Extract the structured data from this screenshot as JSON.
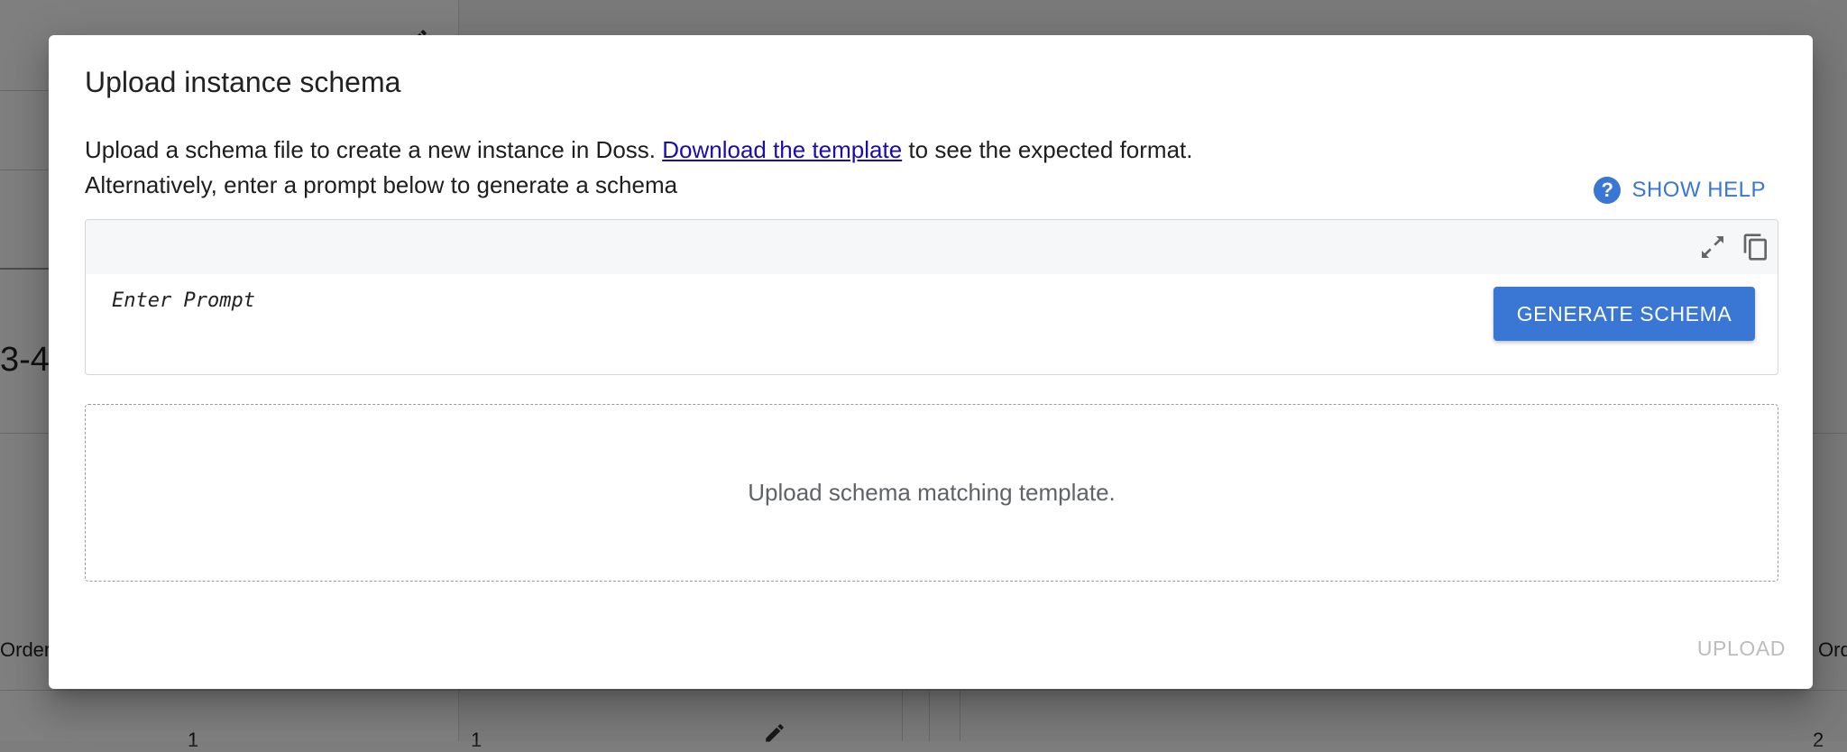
{
  "background": {
    "partial_number": "3-4",
    "column_left": "Order",
    "column_right": "Orde",
    "row_value_1": "1",
    "row_value_2": "1",
    "row_value_3": "2"
  },
  "dialog": {
    "title": "Upload instance schema",
    "description_prefix": "Upload a schema file to create a new instance in Doss. ",
    "template_link": "Download the template",
    "description_suffix": " to see the expected format.",
    "description_line2": "Alternatively, enter a prompt below to generate a schema",
    "show_help_label": "SHOW HELP",
    "prompt_placeholder": "Enter Prompt",
    "generate_button": "GENERATE SCHEMA",
    "dropzone_text": "Upload schema matching template.",
    "upload_button": "UPLOAD"
  },
  "icons": {
    "help": "help-circle-icon",
    "expand": "expand-icon",
    "copy": "copy-icon",
    "edit": "pencil-icon"
  },
  "colors": {
    "accent": "#3a77d4",
    "link": "#1a0dab",
    "disabled": "#bdbdbd"
  }
}
